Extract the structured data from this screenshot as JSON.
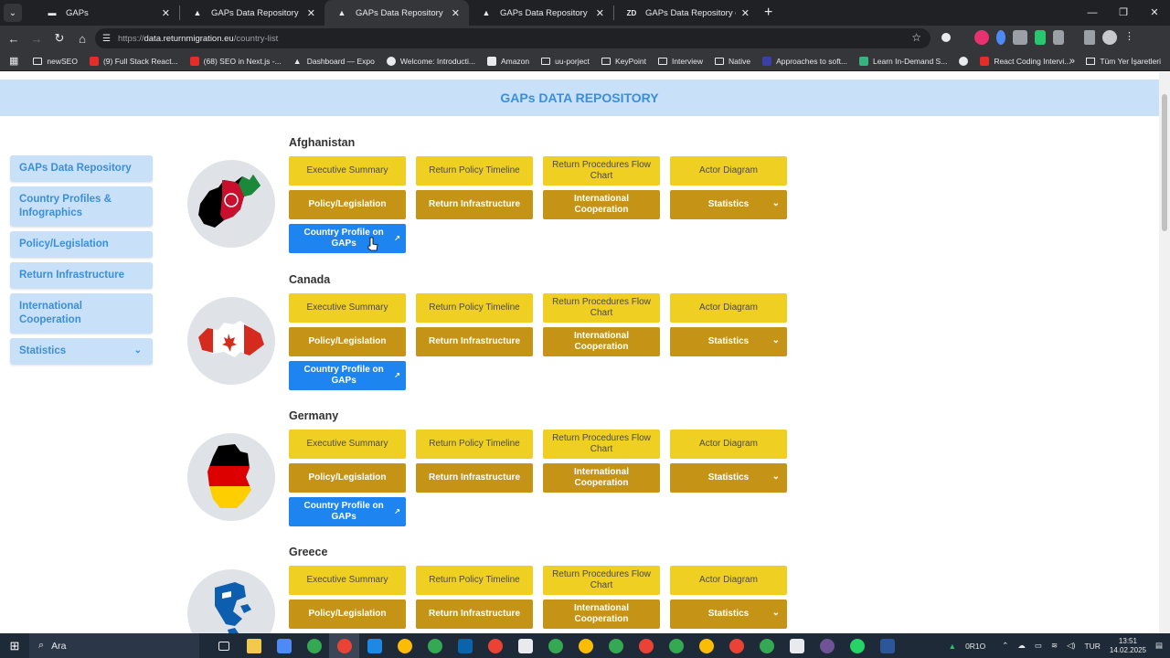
{
  "browser": {
    "tabs": [
      {
        "title": "GAPs",
        "favicon": "gaps-icon",
        "active": false
      },
      {
        "title": "GAPs Data Repository",
        "favicon": "triangle-icon",
        "active": false
      },
      {
        "title": "GAPs Data Repository",
        "favicon": "triangle-icon",
        "active": true
      },
      {
        "title": "GAPs Data Repository",
        "favicon": "triangle-icon",
        "active": false
      },
      {
        "title": "GAPs Data Repository on Retur",
        "favicon": "zd-icon",
        "active": false
      }
    ],
    "url_prefix": "https://",
    "url_host": "data.returnmigration.eu",
    "url_path": "/country-list",
    "bookmarks": [
      {
        "label": "newSEO",
        "icon": "folder"
      },
      {
        "label": "(9) Full Stack React...",
        "icon": "youtube"
      },
      {
        "label": "(68) SEO in Next.js -...",
        "icon": "youtube"
      },
      {
        "label": "Dashboard — Expo",
        "icon": "expo"
      },
      {
        "label": "Welcome: Introducti...",
        "icon": "globe"
      },
      {
        "label": "Amazon",
        "icon": "amazon"
      },
      {
        "label": "uu-porject",
        "icon": "folder"
      },
      {
        "label": "KeyPoint",
        "icon": "folder"
      },
      {
        "label": "Interview",
        "icon": "folder"
      },
      {
        "label": "Native",
        "icon": "folder"
      },
      {
        "label": "Approaches to soft...",
        "icon": "page"
      },
      {
        "label": "Learn In-Demand S...",
        "icon": "page"
      },
      {
        "label": "",
        "icon": "globe"
      },
      {
        "label": "React Coding Intervi...",
        "icon": "youtube"
      }
    ],
    "all_bookmarks": "Tüm Yer İşaretleri"
  },
  "page": {
    "banner_title": "GAPs DATA REPOSITORY",
    "sidebar": [
      {
        "label": "GAPs Data Repository"
      },
      {
        "label": "Country Profiles & Infographics"
      },
      {
        "label": "Policy/Legislation"
      },
      {
        "label": "Return Infrastructure"
      },
      {
        "label": "International Cooperation"
      },
      {
        "label": "Statistics",
        "has_dropdown": true
      }
    ],
    "button_labels": {
      "exec": "Executive Summary",
      "timeline": "Return Policy Timeline",
      "flow": "Return Procedures Flow Chart",
      "actor": "Actor Diagram",
      "policy": "Policy/Legislation",
      "infra": "Return Infrastructure",
      "coop": "International Cooperation",
      "stats": "Statistics",
      "profile": "Country Profile on GAPs"
    },
    "countries": [
      {
        "name": "Afghanistan"
      },
      {
        "name": "Canada"
      },
      {
        "name": "Germany"
      },
      {
        "name": "Greece"
      }
    ],
    "colors": {
      "yellow": "#f0cf23",
      "gold": "#c59416",
      "blue": "#1e84f0",
      "banner": "#c9e1f8"
    }
  },
  "taskbar": {
    "search_placeholder": "Ara",
    "weather": "0R1O",
    "language": "TUR",
    "time": "13:51",
    "date": "14.02.2025"
  }
}
